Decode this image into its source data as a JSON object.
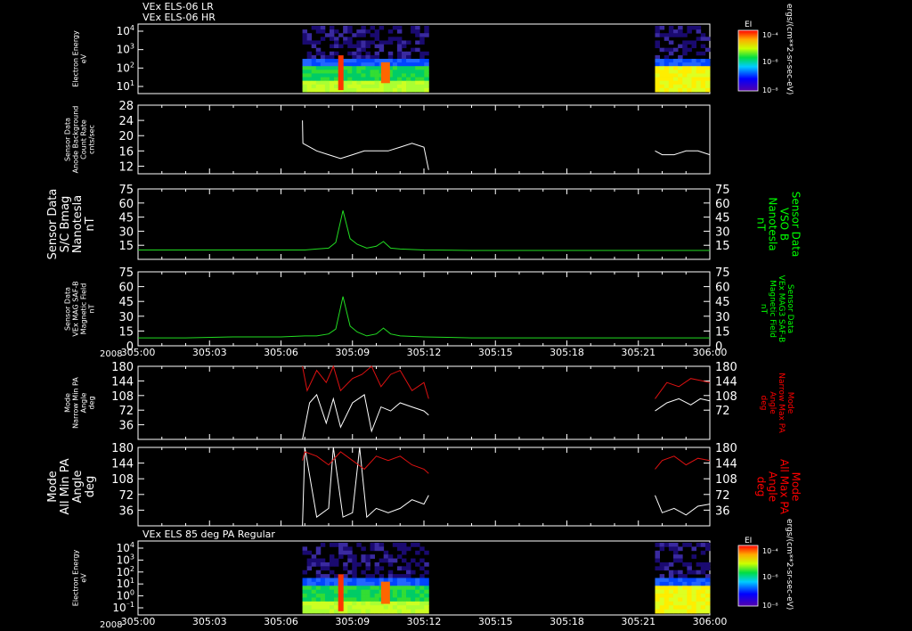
{
  "window": {
    "titles": [
      "VEx ELS-06 LR",
      "VEx ELS-06 HR"
    ],
    "bottom_panel_title": "VEx ELS 85 deg PA Regular",
    "year_label": "2008",
    "x_ticks": [
      "305:00",
      "305:03",
      "305:06",
      "305:09",
      "305:12",
      "305:15",
      "305:18",
      "305:21",
      "306:00"
    ]
  },
  "colors": {
    "background": "#000000",
    "white_trace": "#ffffff",
    "green_trace": "#22dd22",
    "red_trace": "#dd1111",
    "green_label": "#00ff00",
    "red_label": "#ff0000"
  },
  "colorbar": {
    "title": "EI",
    "ticks": [
      "10⁻⁴",
      "10⁻⁶",
      "10⁻⁸"
    ],
    "units": "ergs/(cm**2-sr-sec-eV)"
  },
  "chart_data": [
    {
      "id": "energy-spectrogram-top",
      "type": "heatmap",
      "ylabel": [
        "Electron Energy",
        "eV"
      ],
      "yticks": [
        "10⁴",
        "10³",
        "10²",
        "10¹"
      ],
      "yscale": "log",
      "data_intervals": [
        [
          "305:06.9",
          "305:12.2"
        ],
        [
          "305:21.7",
          "306:00"
        ]
      ]
    },
    {
      "id": "anode-background",
      "type": "line",
      "ylabel": [
        "Sensor Data",
        "Anode Background",
        "Count Rate",
        "cnts/sec"
      ],
      "ylim": [
        10,
        28
      ],
      "yticks": [
        12,
        16,
        20,
        24,
        28
      ],
      "series": [
        {
          "color": "white",
          "x_min": [
            6.9,
            6.92,
            7.5,
            8,
            8.5,
            9,
            9.5,
            10,
            10.5,
            11,
            11.5,
            12,
            12.2,
            21.7,
            22,
            22.5,
            23,
            23.5,
            24
          ],
          "values": [
            24,
            18,
            16,
            15,
            14,
            15,
            16,
            16,
            16,
            17,
            18,
            17,
            11,
            16,
            15,
            15,
            16,
            16,
            15
          ]
        }
      ]
    },
    {
      "id": "mag-sc-bmag",
      "type": "line",
      "ylabel": [
        "Sensor Data",
        "S/C Bmag",
        "Nanotesla",
        "nT"
      ],
      "ylabel_right": [
        "Sensor Data",
        "VSO B",
        "Nanotesla",
        "nT"
      ],
      "ylim": [
        0,
        75
      ],
      "yticks": [
        15,
        30,
        45,
        60,
        75
      ],
      "yticks_right": [
        15,
        30,
        45,
        60,
        75
      ],
      "series": [
        {
          "color": "green",
          "x_min": [
            0,
            2,
            4,
            6,
            7,
            7.5,
            8,
            8.3,
            8.6,
            8.9,
            9.2,
            9.6,
            10,
            10.3,
            10.6,
            11,
            12,
            14,
            16,
            18,
            20,
            22,
            24
          ],
          "values": [
            10,
            10,
            10,
            10,
            10,
            11,
            12,
            18,
            52,
            22,
            16,
            12,
            14,
            19,
            12,
            11,
            10,
            9.5,
            9.5,
            9.5,
            9.5,
            9.5,
            9.5
          ]
        }
      ]
    },
    {
      "id": "mag-vso-b",
      "type": "line",
      "ylabel": [
        "Sensor Data",
        "VEx MAG SAF-B",
        "Magnetic Field",
        "nT"
      ],
      "ylabel_right": [
        "Sensor Data",
        "VEx MAG3 SAF-B",
        "Magnetic Field",
        "nT"
      ],
      "ylim": [
        0,
        75
      ],
      "yticks": [
        0,
        15,
        30,
        45,
        60,
        75
      ],
      "yticks_right": [
        0,
        15,
        30,
        45,
        60,
        75
      ],
      "series": [
        {
          "color": "green",
          "x_min": [
            0,
            2,
            4,
            6,
            7,
            7.5,
            8,
            8.3,
            8.6,
            8.9,
            9.2,
            9.6,
            10,
            10.3,
            10.6,
            11,
            12,
            14,
            16,
            18,
            20,
            22,
            24
          ],
          "values": [
            8,
            8,
            9,
            9,
            10,
            10,
            12,
            17,
            50,
            20,
            14,
            10,
            12,
            18,
            12,
            10,
            9,
            8,
            8,
            8,
            8,
            8,
            8
          ]
        }
      ]
    },
    {
      "id": "narrow-pa",
      "type": "line",
      "ylabel": [
        "Mode",
        "Narrow Min PA",
        "Angle",
        "deg"
      ],
      "ylabel_right": [
        "Mode",
        "Narrow Max PA",
        "Angle",
        "deg"
      ],
      "ylim": [
        0,
        180
      ],
      "yticks": [
        36,
        72,
        108,
        144,
        180
      ],
      "yticks_right": [
        72,
        108,
        144,
        180
      ],
      "series": [
        {
          "color": "white",
          "x_min": [
            6.9,
            7.2,
            7.5,
            7.9,
            8.2,
            8.5,
            9,
            9.5,
            9.8,
            10.2,
            10.6,
            11,
            11.5,
            12,
            12.2,
            21.7,
            22.2,
            22.7,
            23.2,
            23.6,
            24
          ],
          "values": [
            0,
            90,
            110,
            40,
            100,
            30,
            90,
            110,
            20,
            80,
            70,
            90,
            80,
            70,
            60,
            70,
            90,
            100,
            85,
            100,
            95
          ]
        },
        {
          "color": "red",
          "x_min": [
            6.9,
            7.1,
            7.5,
            7.9,
            8.2,
            8.5,
            9,
            9.4,
            9.8,
            10.2,
            10.6,
            11,
            11.5,
            12,
            12.2,
            21.7,
            22.2,
            22.7,
            23.2,
            23.6,
            24
          ],
          "values": [
            180,
            120,
            170,
            140,
            180,
            120,
            150,
            160,
            180,
            130,
            160,
            170,
            120,
            140,
            100,
            100,
            140,
            130,
            150,
            145,
            140
          ]
        }
      ]
    },
    {
      "id": "all-pa",
      "type": "line",
      "ylabel": [
        "Mode",
        "All Min PA",
        "Angle",
        "deg"
      ],
      "ylabel_right": [
        "Mode",
        "All Max PA",
        "Angle",
        "deg"
      ],
      "ylim": [
        0,
        180
      ],
      "yticks": [
        36,
        72,
        108,
        144,
        180
      ],
      "yticks_right": [
        36,
        72,
        108,
        144,
        180
      ],
      "series": [
        {
          "color": "white",
          "x_min": [
            6.9,
            7,
            7.5,
            8,
            8.2,
            8.6,
            9,
            9.3,
            9.6,
            10,
            10.5,
            11,
            11.5,
            12,
            12.2,
            21.7,
            22,
            22.5,
            23,
            23.5,
            24
          ],
          "values": [
            0,
            180,
            20,
            40,
            180,
            20,
            30,
            180,
            20,
            40,
            30,
            40,
            60,
            50,
            70,
            70,
            30,
            40,
            25,
            45,
            50
          ]
        },
        {
          "color": "red",
          "x_min": [
            6.9,
            7,
            7.5,
            8,
            8.5,
            9,
            9.5,
            10,
            10.5,
            11,
            11.5,
            12,
            12.2,
            21.7,
            22,
            22.5,
            23,
            23.5,
            24
          ],
          "values": [
            150,
            170,
            160,
            140,
            170,
            150,
            130,
            160,
            150,
            160,
            140,
            130,
            120,
            130,
            150,
            160,
            140,
            155,
            150
          ]
        }
      ]
    },
    {
      "id": "energy-spectrogram-85pa",
      "type": "heatmap",
      "ylabel": [
        "Electron Energy",
        "eV"
      ],
      "yticks": [
        "10⁴",
        "10³",
        "10²",
        "10¹",
        "10⁰",
        "10⁻¹"
      ],
      "yscale": "log",
      "data_intervals": [
        [
          "305:06.9",
          "305:12.2"
        ],
        [
          "305:21.7",
          "306:00"
        ]
      ]
    }
  ]
}
